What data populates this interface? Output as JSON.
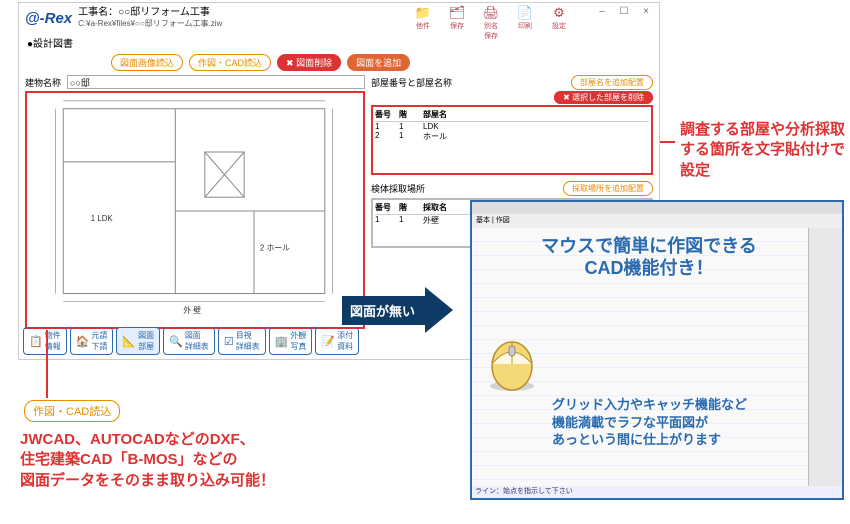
{
  "window": {
    "logo": "@-Rex",
    "title": "工事名：○○邸リフォーム工事",
    "path": "C:¥a-Rex¥files¥○○邸リフォーム工事.ziw",
    "toolbar": [
      {
        "icon": "📁",
        "label": "他件"
      },
      {
        "icon": "🗂",
        "label": "保存"
      },
      {
        "icon": "🖨",
        "label": "別名保存"
      },
      {
        "icon": "📄",
        "label": "印刷"
      },
      {
        "icon": "⚙",
        "label": "設定"
      }
    ],
    "winctl": [
      "–",
      "☐",
      "×"
    ]
  },
  "section": "●設計図書",
  "actions": {
    "a1": "図面画像読込",
    "a2": "作図・CAD読込",
    "a3": "図面削除",
    "a4": "図面を追加"
  },
  "left": {
    "field_label": "建物名称",
    "field_value": "○○邸",
    "plan_rooms": {
      "ldk": "1 LDK",
      "hall": "2 ホール",
      "ext": "外 壁"
    }
  },
  "right": {
    "rooms": {
      "title": "部屋番号と部屋名称",
      "btn1": "部屋名を追加配置",
      "btn2": "選択した部屋を削除",
      "cols": [
        "番号",
        "階",
        "部屋名"
      ],
      "rows": [
        {
          "no": "1",
          "fl": "1",
          "nm": "LDK"
        },
        {
          "no": "2",
          "fl": "1",
          "nm": "ホール"
        }
      ]
    },
    "samples": {
      "title": "検体採取場所",
      "btn1": "採取場所を追加配置",
      "cols": [
        "番号",
        "階",
        "採取名"
      ],
      "rows": [
        {
          "no": "1",
          "fl": "1",
          "nm": "外壁"
        }
      ]
    }
  },
  "tabs": [
    {
      "icon": "📋",
      "label": "物件\n情報"
    },
    {
      "icon": "🏠",
      "label": "元請\n下請"
    },
    {
      "icon": "📐",
      "label": "図面\n部屋"
    },
    {
      "icon": "🔍",
      "label": "図面\n詳細表"
    },
    {
      "icon": "☑",
      "label": "目視\n詳細表"
    },
    {
      "icon": "🏢",
      "label": "外観\n写真"
    },
    {
      "icon": "📝",
      "label": "添付\n資料"
    }
  ],
  "callouts": {
    "cadread": "作図・CAD読込",
    "cad_desc": "JWCAD、AUTOCADなどのDXF、\n住宅建築CAD「B-MOS」などの\n図面データをそのまま取り込み可能！",
    "room_desc": "調査する部屋や分析採取\nする箇所を文字貼付けで\n設定",
    "arrow": "図面が無い",
    "cad_big": "マウスで簡単に作図できる\nCAD機能付き！",
    "cad_small": "グリッド入力やキャッチ機能など\n機能満載でラフな平面図が\nあっという間に仕上がります"
  },
  "cad": {
    "tabs": "基本 | 作図",
    "status": "ライン：始点を指示して下さい"
  }
}
